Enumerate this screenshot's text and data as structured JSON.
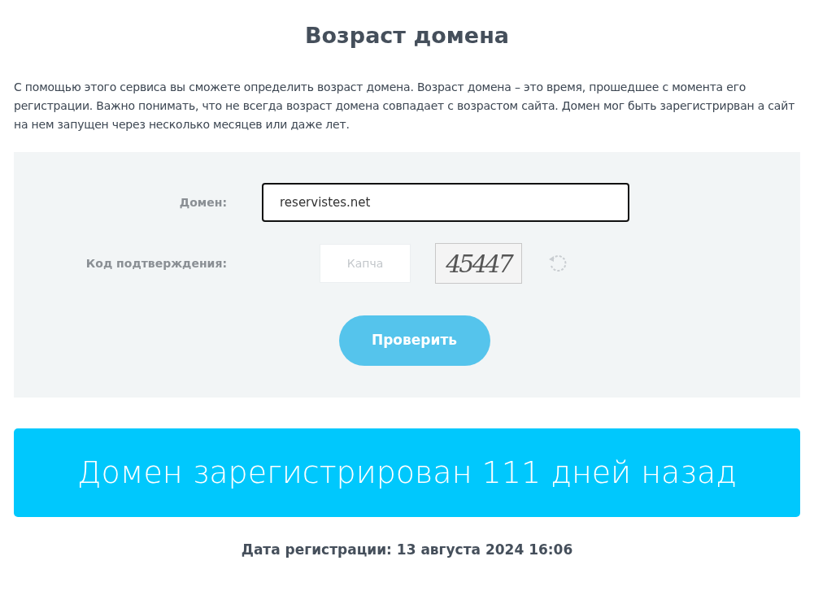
{
  "title": "Возраст домена",
  "description": "С помощью этого сервиса вы сможете определить возраст домена. Возраст домена – это время, прошедшее с момента его регистрации. Важно понимать, что не всегда возраст домена совпадает с возрастом сайта. Домен мог быть зарегистрирван а сайт на нем запущен через несколько месяцев или даже лет.",
  "form": {
    "domain": {
      "label": "Домен:",
      "value": "reservistes.net"
    },
    "captcha": {
      "label": "Код подтверждения:",
      "placeholder": "Капча",
      "image_text": "45447"
    },
    "submit": "Проверить"
  },
  "result": {
    "message": "Домен зарегистрирован 111 дней назад",
    "date": "Дата регистрации: 13 августа 2024 16:06"
  }
}
